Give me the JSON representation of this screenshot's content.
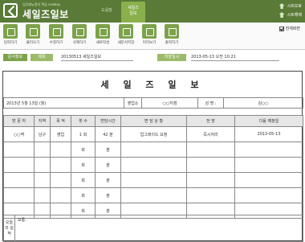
{
  "header": {
    "tagline": "업무매뉴얼의 핵심 cowbey",
    "brand": "세일즈일보",
    "tab_guide": "도움말",
    "tab_form_line1": "세일즈",
    "tab_form_line2": "일보",
    "save_label": "시트보호",
    "delete_label": "시트해제",
    "accent": "#5a7a38",
    "accent_light": "#8ab04c"
  },
  "toolbar": {
    "items": [
      {
        "label": "입력하기",
        "icon": "pencil-icon"
      },
      {
        "label": "불러오기",
        "icon": "download-icon"
      },
      {
        "label": "수정하기",
        "icon": "refresh-icon"
      },
      {
        "label": "삭제하기",
        "icon": "trash-icon"
      },
      {
        "label": "새로작성",
        "icon": "reload-icon"
      },
      {
        "label": "새문서저장",
        "icon": "save-icon"
      },
      {
        "label": "미리보기",
        "icon": "monitor-icon"
      },
      {
        "label": "출력하기",
        "icon": "printer-icon"
      }
    ],
    "fullscreen_label": "전체화면"
  },
  "docbar": {
    "tag_doc": "문서정보",
    "tag_title": "제목",
    "title_value": "20130513 세일즈일보",
    "tag_saved": "저장일시",
    "saved_value": "2013-05-13  오전 10:21"
  },
  "paper": {
    "title": "세 일 즈 일 보",
    "date": "2013년 5월 13일 (월)",
    "office_label": "영업소",
    "office_value": "○○지점",
    "name_label": "성  명 :",
    "name_value": "김○○",
    "columns": [
      "방 문 처",
      "지역",
      "목  적",
      "횟 수",
      "면담시간",
      "면  담  상  황",
      "전  망",
      "다음 예정일"
    ],
    "rows": [
      {
        "place": "○○역",
        "region": "남구",
        "purpose": "영업",
        "count": "1",
        "count_unit": "회",
        "minutes": "42",
        "minutes_unit": "분",
        "status": "업그레이드 요청",
        "outlook": "즉시처리",
        "next": "2013-05-13"
      },
      {
        "place": "",
        "region": "",
        "purpose": "",
        "count": "",
        "count_unit": "회",
        "minutes": "",
        "minutes_unit": "분",
        "status": "",
        "outlook": "",
        "next": ""
      },
      {
        "place": "",
        "region": "",
        "purpose": "",
        "count": "",
        "count_unit": "회",
        "minutes": "",
        "minutes_unit": "분",
        "status": "",
        "outlook": "",
        "next": ""
      },
      {
        "place": "",
        "region": "",
        "purpose": "",
        "count": "",
        "count_unit": "회",
        "minutes": "",
        "minutes_unit": "분",
        "status": "",
        "outlook": "",
        "next": ""
      },
      {
        "place": "",
        "region": "",
        "purpose": "",
        "count": "",
        "count_unit": "회",
        "minutes": "",
        "minutes_unit": "분",
        "status": "",
        "outlook": "",
        "next": ""
      },
      {
        "place": "",
        "region": "",
        "purpose": "",
        "count": "",
        "count_unit": "회",
        "minutes": "",
        "minutes_unit": "분",
        "status": "",
        "outlook": "",
        "next": ""
      }
    ],
    "bottom_label": "오늘의 실적",
    "bottom_value": "보통."
  }
}
